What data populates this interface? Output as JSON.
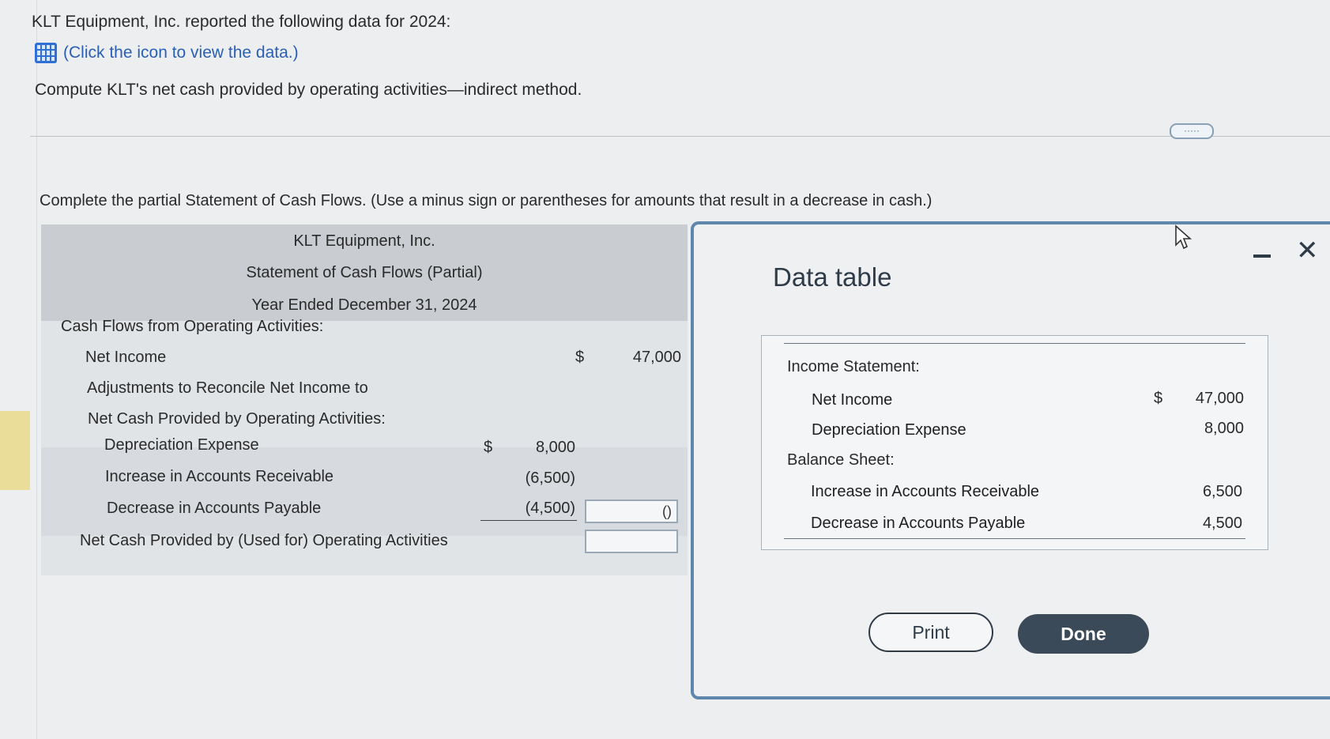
{
  "intro": {
    "line1": "KLT Equipment, Inc. reported the following data for 2024:",
    "data_link": "(Click the icon to view the data.)",
    "question": "Compute KLT's net cash provided by operating activities—indirect method."
  },
  "more_label": "·····",
  "instructions": "Complete the partial Statement of Cash Flows. (Use a minus sign or parentheses for amounts that result in a decrease in cash.)",
  "statement": {
    "company": "KLT Equipment, Inc.",
    "title": "Statement of Cash Flows (Partial)",
    "period": "Year Ended December 31, 2024",
    "section": "Cash Flows from Operating Activities:",
    "net_income_label": "Net Income",
    "net_income_dollar": "$",
    "net_income_value": "47,000",
    "adjust_line1": "Adjustments to Reconcile Net Income to",
    "adjust_line2": "Net Cash Provided by Operating Activities:",
    "depreciation_label": "Depreciation Expense",
    "depreciation_dollar": "$",
    "depreciation_value": "8,000",
    "ar_label": "Increase in Accounts Receivable",
    "ar_value": "(6,500)",
    "ap_label": "Decrease in Accounts Payable",
    "ap_value": "(4,500)",
    "adjust_total_input": "()",
    "net_cash_label": "Net Cash Provided by (Used for) Operating Activities",
    "net_cash_input": ""
  },
  "modal": {
    "title": "Data table",
    "income_statement_label": "Income Statement:",
    "net_income_label": "Net Income",
    "net_income_dollar": "$",
    "net_income_value": "47,000",
    "depreciation_label": "Depreciation Expense",
    "depreciation_value": "8,000",
    "balance_sheet_label": "Balance Sheet:",
    "ar_label": "Increase in Accounts Receivable",
    "ar_value": "6,500",
    "ap_label": "Decrease in Accounts Payable",
    "ap_value": "4,500",
    "print_label": "Print",
    "done_label": "Done",
    "close_glyph": "✕"
  }
}
